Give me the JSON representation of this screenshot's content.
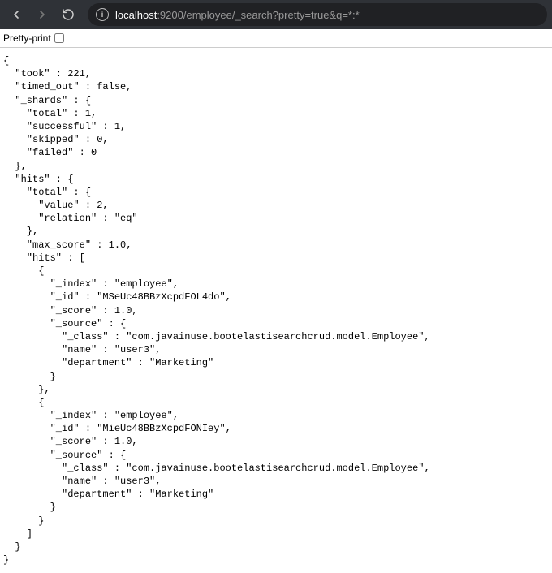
{
  "navbar": {
    "url_host": "localhost",
    "url_port": ":9200",
    "url_path": "/employee/_search?pretty=true&q=*:*"
  },
  "toolbar": {
    "pretty_print_label": "Pretty-print"
  },
  "response": {
    "took": 221,
    "timed_out": false,
    "_shards": {
      "total": 1,
      "successful": 1,
      "skipped": 0,
      "failed": 0
    },
    "hits": {
      "total": {
        "value": 2,
        "relation": "eq"
      },
      "max_score": 1.0,
      "hits": [
        {
          "_index": "employee",
          "_id": "MSeUc48BBzXcpdFOL4do",
          "_score": 1.0,
          "_source": {
            "_class": "com.javainuse.bootelastisearchcrud.model.Employee",
            "name": "user3",
            "department": "Marketing"
          }
        },
        {
          "_index": "employee",
          "_id": "MieUc48BBzXcpdFONIey",
          "_score": 1.0,
          "_source": {
            "_class": "com.javainuse.bootelastisearchcrud.model.Employee",
            "name": "user3",
            "department": "Marketing"
          }
        }
      ]
    }
  }
}
